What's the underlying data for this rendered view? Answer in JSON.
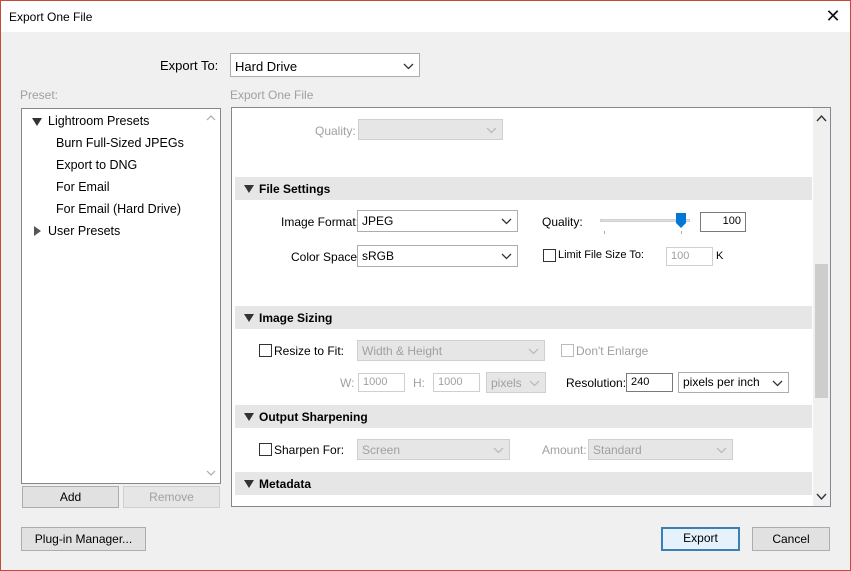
{
  "window": {
    "title": "Export One File"
  },
  "export_to": {
    "label": "Export To:",
    "value": "Hard Drive"
  },
  "preset": {
    "label": "Preset:",
    "groups": [
      {
        "label": "Lightroom Presets",
        "expanded": true
      },
      {
        "label": "User Presets",
        "expanded": false
      }
    ],
    "items": [
      "Burn Full-Sized JPEGs",
      "Export to DNG",
      "For Email",
      "For Email (Hard Drive)"
    ],
    "add_label": "Add",
    "remove_label": "Remove"
  },
  "panel_title": "Export One File",
  "quality_top": {
    "label": "Quality:",
    "value": ""
  },
  "file_settings": {
    "title": "File Settings",
    "image_format_label": "Image Format:",
    "image_format_value": "JPEG",
    "color_space_label": "Color Space:",
    "color_space_value": "sRGB",
    "quality_label": "Quality:",
    "quality_value": "100",
    "quality_fraction": 1.0,
    "limit_label": "Limit File Size To:",
    "limit_value": "100",
    "limit_unit": "K"
  },
  "image_sizing": {
    "title": "Image Sizing",
    "resize_label": "Resize to Fit:",
    "resize_value": "Width & Height",
    "dont_enlarge_label": "Don't Enlarge",
    "w_label": "W:",
    "w_value": "1000",
    "h_label": "H:",
    "h_value": "1000",
    "unit_value": "pixels",
    "resolution_label": "Resolution:",
    "resolution_value": "240",
    "resolution_unit": "pixels per inch"
  },
  "output_sharpening": {
    "title": "Output Sharpening",
    "sharpen_label": "Sharpen For:",
    "sharpen_value": "Screen",
    "amount_label": "Amount:",
    "amount_value": "Standard"
  },
  "metadata": {
    "title": "Metadata"
  },
  "footer": {
    "plugin_label": "Plug-in Manager...",
    "export_label": "Export",
    "cancel_label": "Cancel"
  }
}
